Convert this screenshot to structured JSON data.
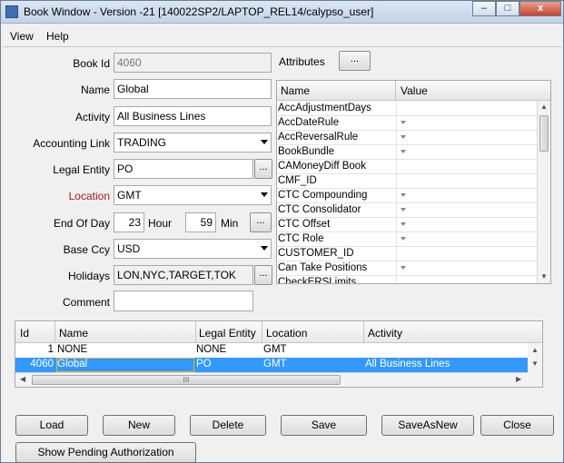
{
  "window": {
    "title": "Book Window - Version -21 [140022SP2/LAPTOP_REL14/calypso_user]",
    "minimize": "–",
    "maximize": "□",
    "close": "x"
  },
  "menu": {
    "view": "View",
    "help": "Help"
  },
  "form": {
    "book_id_label": "Book Id",
    "book_id": "4060",
    "name_label": "Name",
    "name": "Global",
    "activity_label": "Activity",
    "activity": "All Business Lines",
    "accounting_link_label": "Accounting Link",
    "accounting_link": "TRADING",
    "legal_entity_label": "Legal Entity",
    "legal_entity": "PO",
    "location_label": "Location",
    "location": "GMT",
    "end_of_day_label": "End Of Day",
    "hour_value": "23",
    "hour_label": "Hour",
    "min_value": "59",
    "min_label": "Min",
    "base_ccy_label": "Base Ccy",
    "base_ccy": "USD",
    "holidays_label": "Holidays",
    "holidays": "LON,NYC,TARGET,TOK",
    "comment_label": "Comment",
    "comment": "",
    "ellipsis": "..."
  },
  "attributes": {
    "label": "Attributes",
    "columns": [
      "Name",
      "Value"
    ],
    "rows": [
      {
        "name": "AccAdjustmentDays",
        "dropdown": false
      },
      {
        "name": "AccDateRule",
        "dropdown": true
      },
      {
        "name": "AccReversalRule",
        "dropdown": true
      },
      {
        "name": "BookBundle",
        "dropdown": true
      },
      {
        "name": "CAMoneyDiff Book",
        "dropdown": false
      },
      {
        "name": "CMF_ID",
        "dropdown": false
      },
      {
        "name": "CTC Compounding",
        "dropdown": true
      },
      {
        "name": "CTC Consolidator",
        "dropdown": true
      },
      {
        "name": "CTC Offset",
        "dropdown": true
      },
      {
        "name": "CTC Role",
        "dropdown": true
      },
      {
        "name": "CUSTOMER_ID",
        "dropdown": false
      },
      {
        "name": "Can Take Positions",
        "dropdown": true
      },
      {
        "name": "CheckERSLimits",
        "dropdown": false
      }
    ]
  },
  "books": {
    "columns": [
      "Id",
      "Name",
      "Legal Entity",
      "Location",
      "Activity"
    ],
    "rows": [
      {
        "id": "1",
        "name": "NONE",
        "legal_entity": "NONE",
        "location": "GMT",
        "activity": "",
        "selected": false
      },
      {
        "id": "4060",
        "name": "Global",
        "legal_entity": "PO",
        "location": "GMT",
        "activity": "All Business Lines",
        "selected": true
      }
    ],
    "scroll_grip": "III"
  },
  "buttons": {
    "load": "Load",
    "new": "New",
    "delete": "Delete",
    "save": "Save",
    "save_as_new": "SaveAsNew",
    "close": "Close",
    "show_pending": "Show Pending Authorization"
  }
}
